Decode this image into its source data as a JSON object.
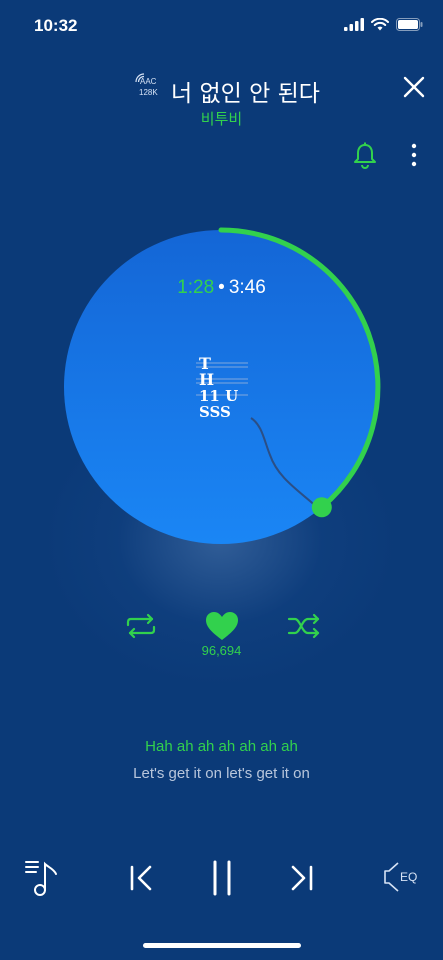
{
  "status_bar": {
    "time": "10:32"
  },
  "codec": {
    "format": "AAC",
    "bitrate": "128K"
  },
  "song": {
    "title": "너 없인 안 된다",
    "artist": "비투비"
  },
  "player": {
    "current_time": "1:28",
    "separator": "•",
    "total_time": "3:46",
    "progress_fraction": 0.389,
    "like_count": "96,694",
    "album_art_text": {
      "line1": "T",
      "line2": "H",
      "line3": "11 U",
      "line4": "SSS"
    }
  },
  "lyrics": {
    "current": "Hah ah ah ah ah ah ah",
    "next": "Let's get it on let's get it on"
  },
  "bottom_bar": {
    "eq_label": "EQ"
  },
  "colors": {
    "background": "#0b3a78",
    "accent_green": "#32d14d",
    "circle_top": "#1466d6",
    "circle_bottom": "#1a86f5"
  }
}
